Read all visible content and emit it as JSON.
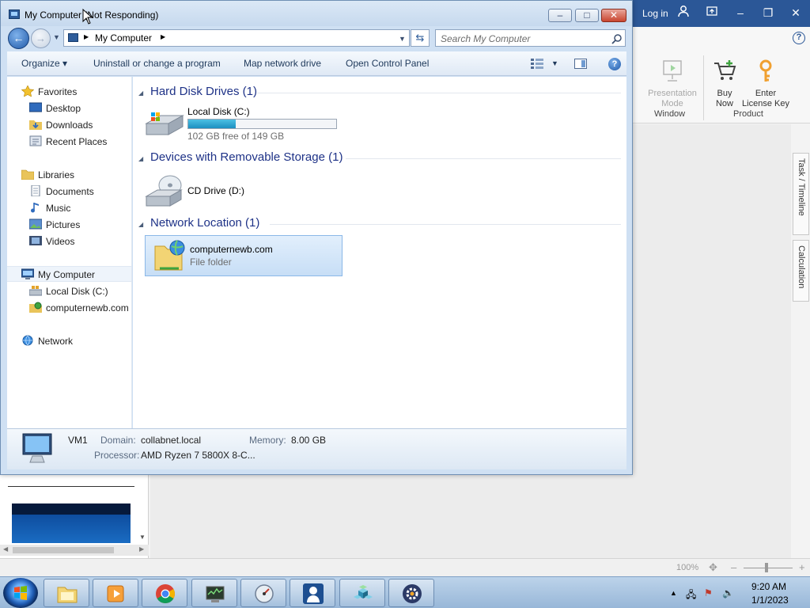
{
  "window": {
    "title": "My Computer (Not Responding)",
    "caption_buttons": {
      "minimize": "–",
      "maximize": "□",
      "close": "✕"
    }
  },
  "address": {
    "path": "My Computer",
    "search_placeholder": "Search My Computer"
  },
  "toolbar": {
    "organize": "Organize ▾",
    "uninstall": "Uninstall or change a program",
    "map_drive": "Map network drive",
    "control_panel": "Open Control Panel"
  },
  "nav": {
    "favorites": "Favorites",
    "desktop": "Desktop",
    "downloads": "Downloads",
    "recent_places": "Recent Places",
    "libraries": "Libraries",
    "documents": "Documents",
    "music": "Music",
    "pictures": "Pictures",
    "videos": "Videos",
    "my_computer": "My Computer",
    "local_disk": "Local Disk (C:)",
    "network_folder": "computernewb.com",
    "network": "Network"
  },
  "content": {
    "groups": {
      "hard_disks": "Hard Disk Drives (1)",
      "removable": "Devices with Removable Storage (1)",
      "network_location": "Network Location (1)"
    },
    "local_disk": {
      "name": "Local Disk (C:)",
      "free_text": "102 GB free of 149 GB",
      "used_fraction": 0.32
    },
    "cd_drive": {
      "name": "CD Drive (D:)"
    },
    "network_item": {
      "name": "computernewb.com",
      "type": "File folder"
    }
  },
  "details": {
    "computer_name": "VM1",
    "domain_label": "Domain:",
    "domain_value": "collabnet.local",
    "memory_label": "Memory:",
    "memory_value": "8.00 GB",
    "processor_label": "Processor:",
    "processor_value": "AMD Ryzen 7 5800X 8-C..."
  },
  "background_app": {
    "login": "Log in",
    "ribbon": {
      "presentation_mode": "Presentation Mode",
      "buy_now": "Buy Now",
      "enter_license": "Enter License Key",
      "group_window": "Window",
      "group_product": "Product"
    },
    "side_tabs": {
      "task_timeline": "Task / Timeline",
      "calculation": "Calculation"
    },
    "zoom": "100%"
  },
  "taskbar": {
    "time": "9:20 AM",
    "date": "1/1/2023"
  },
  "colors": {
    "window_frame": "#cfe0f3",
    "group_header_text": "#1e3287",
    "capacity_fill": "#1b8fc0",
    "app_titlebar": "#2b5797"
  }
}
